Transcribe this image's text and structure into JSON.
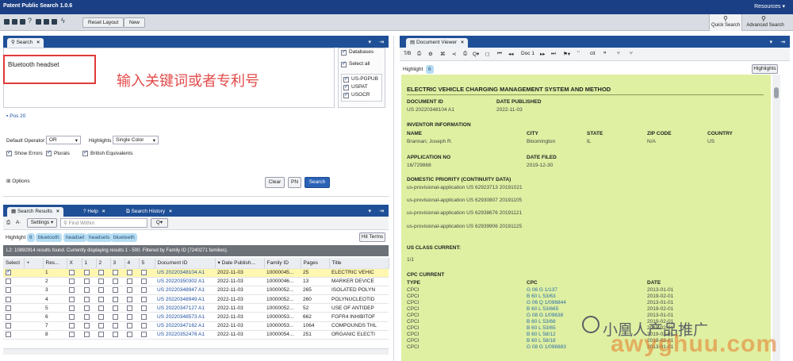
{
  "app": {
    "title": "Patent Public Search 1.0.6",
    "resources": "Resources ▾"
  },
  "toolbar": {
    "reset_layout": "Reset Layout",
    "new": "New",
    "quick_search": "Quick Search",
    "advanced_search": "Advanced Search"
  },
  "search_panel": {
    "tab": "Search",
    "query": "Bluetooth headset",
    "annotation": "输入关键词或者专利号",
    "pos_label": "Pos 20",
    "databases_label": "Databases",
    "select_all": "Select all",
    "databases": [
      "US-PGPUB",
      "USPAT",
      "USOCR"
    ],
    "default_operator_label": "Default Operator:",
    "default_operator": "OR",
    "highlights_label": "Highlights",
    "highlights": "Single Color",
    "show_errors": "Show Errors",
    "plurals": "Plurals",
    "british": "British Equivalents",
    "options": "Options",
    "clear": "Clear",
    "pn": "PN",
    "search": "Search"
  },
  "results_panel": {
    "tabs": [
      "Search Results",
      "Help",
      "Search History"
    ],
    "settings": "Settings ▾",
    "find_placeholder": "Find Within",
    "qmenu": "Q▾",
    "highlight_label": "Highlight",
    "chips": [
      "6",
      "bluetooth",
      "headset",
      "headsets",
      "blueteeth"
    ],
    "hit_terms": "Hit Terms",
    "status": "L2: 10892914 results found. Currently displaying results 1 - 500. Filtered by Family ID (7240271 families).",
    "columns": [
      "Select",
      "+",
      "Res...",
      "X",
      "1",
      "2",
      "3",
      "4",
      "5",
      "Document ID",
      "▾ Date Publish...",
      "Family ID",
      "Pages",
      "Title"
    ],
    "rows": [
      {
        "n": "1",
        "doc": "US 20220348104 A1",
        "date": "2022-11-03",
        "fam": "10000045...",
        "pages": "25",
        "title": "ELECTRIC VEHIC"
      },
      {
        "n": "2",
        "doc": "US 20220350302 A1",
        "date": "2022-11-03",
        "fam": "10000046...",
        "pages": "13",
        "title": "MARKER DEVICE"
      },
      {
        "n": "3",
        "doc": "US 20220348947 A1",
        "date": "2022-11-03",
        "fam": "10000052...",
        "pages": "265",
        "title": "ISOLATED POLYN"
      },
      {
        "n": "4",
        "doc": "US 20220348949 A1",
        "date": "2022-11-03",
        "fam": "10000052...",
        "pages": "260",
        "title": "POLYNUCLEOTID"
      },
      {
        "n": "5",
        "doc": "US 20220347127 A1",
        "date": "2022-11-03",
        "fam": "10000052...",
        "pages": "52",
        "title": "USE OF ANTIDEP"
      },
      {
        "n": "6",
        "doc": "US 20220348573 A1",
        "date": "2022-11-03",
        "fam": "10000053...",
        "pages": "662",
        "title": "FGFR4 INHIBITOF"
      },
      {
        "n": "7",
        "doc": "US 20220347162 A1",
        "date": "2022-11-03",
        "fam": "10000053...",
        "pages": "1064",
        "title": "COMPOUNDS THL"
      },
      {
        "n": "8",
        "doc": "US 20220352476 A1",
        "date": "2022-11-03",
        "fam": "10000054...",
        "pages": "251",
        "title": "ORGANIC ELECTI"
      }
    ]
  },
  "doc_viewer": {
    "tab": "Document Viewer",
    "doc_label": "Doc 1",
    "highlight_label": "Highlight",
    "highlight_count": "6",
    "highlights_btn": "Highlights",
    "title": "ELECTRIC VEHICLE CHARGING MANAGEMENT SYSTEM AND METHOD",
    "document_id_label": "DOCUMENT ID",
    "document_id": "US 20220348104 A1",
    "date_published_label": "DATE PUBLISHED",
    "date_published": "2022-11-03",
    "inventor_info_label": "INVENTOR INFORMATION",
    "name_label": "NAME",
    "city_label": "CITY",
    "state_label": "STATE",
    "zip_label": "ZIP CODE",
    "country_label": "COUNTRY",
    "inventor_name": "Brannan; Joseph R.",
    "inventor_city": "Bloomington",
    "inventor_state": "IL",
    "inventor_zip": "N/A",
    "inventor_country": "US",
    "application_no_label": "APPLICATION NO",
    "application_no": "16/729868",
    "date_filed_label": "DATE FILED",
    "date_filed": "2019-12-30",
    "domestic_priority_label": "DOMESTIC PRIORITY (CONTINUITY DATA)",
    "priorities": [
      "us-provisional-application US 62923713 20191021",
      "us-provisional-application US 62930807 20191105",
      "us-provisional-application US 62938676 20191121",
      "us-provisional-application US 62939906 20191125"
    ],
    "us_class_label": "US CLASS CURRENT:",
    "us_class": "1/1",
    "cpc_label": "CPC CURRENT",
    "cpc_type_label": "TYPE",
    "cpc_cpc_label": "CPC",
    "cpc_date_label": "DATE",
    "cpc_rows": [
      {
        "type": "CPCI",
        "cpc": "G 06 G 1/137",
        "date": "2013-01-01"
      },
      {
        "type": "CPCI",
        "cpc": "B 60 L 53/63",
        "date": "2019-02-01"
      },
      {
        "type": "CPCI",
        "cpc": "G 06 Q 1/096844",
        "date": "2013-01-01"
      },
      {
        "type": "CPCI",
        "cpc": "B 60 L 53/665",
        "date": "2019-02-01"
      },
      {
        "type": "CPCI",
        "cpc": "G 08 G 1/09638",
        "date": "2013-01-01"
      },
      {
        "type": "CPCI",
        "cpc": "B 60 L 53/68",
        "date": "2019-02-01"
      },
      {
        "type": "CPCI",
        "cpc": "B 60 L 53/65",
        "date": "2019-02-01"
      },
      {
        "type": "CPCI",
        "cpc": "B 60 L 58/12",
        "date": "2019-02-01"
      },
      {
        "type": "CPCI",
        "cpc": "B 60 L 58/18",
        "date": "2019-02-01"
      },
      {
        "type": "CPCI",
        "cpc": "G 08 G 1/096883",
        "date": "2013-01-01"
      }
    ]
  },
  "watermark": {
    "line1": "小凰人产品推广",
    "line2": "awyghuu.com"
  }
}
